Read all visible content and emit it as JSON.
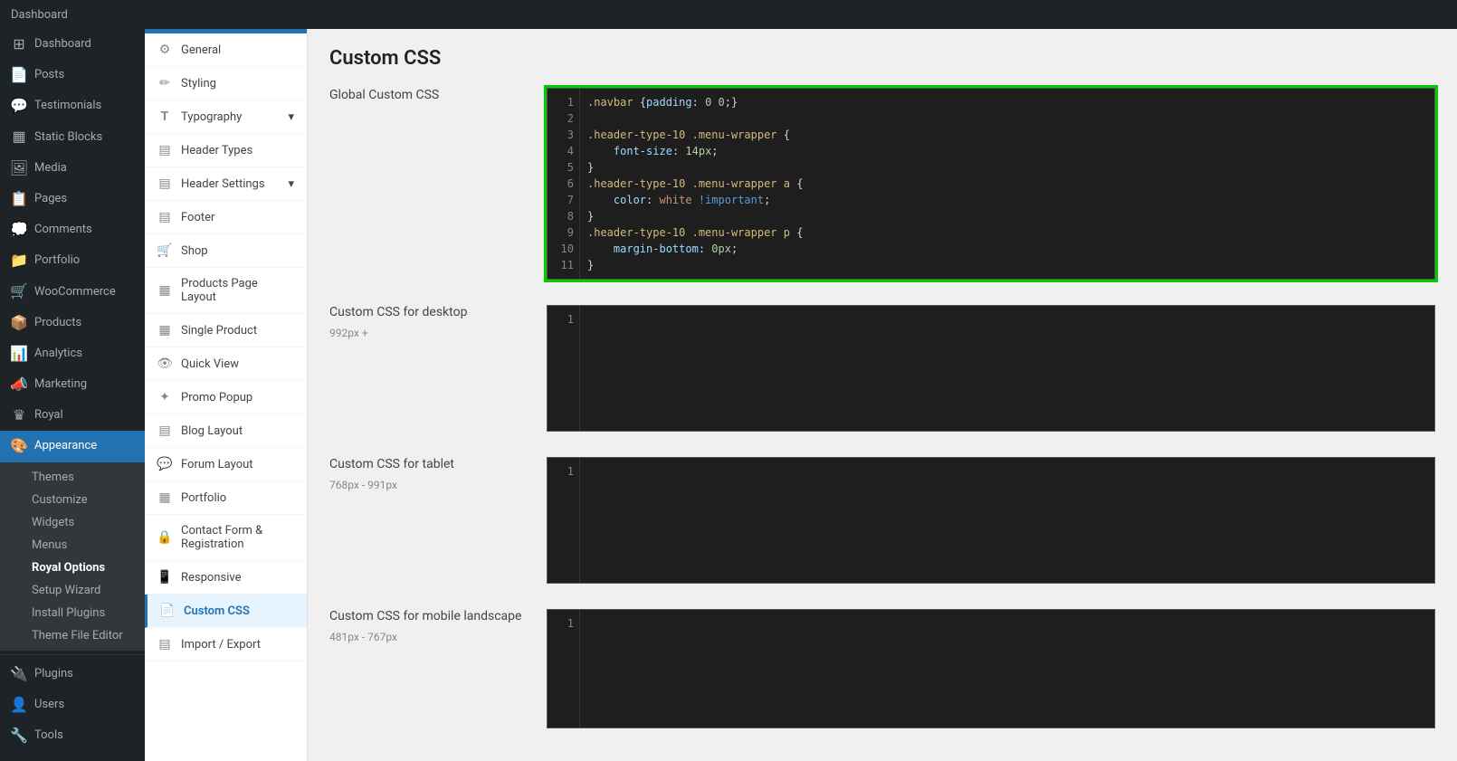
{
  "adminBar": {
    "dashboardLabel": "Dashboard"
  },
  "sidebar": {
    "items": [
      {
        "id": "dashboard",
        "label": "Dashboard",
        "icon": "⊞",
        "active": false
      },
      {
        "id": "posts",
        "label": "Posts",
        "icon": "📄",
        "active": false
      },
      {
        "id": "testimonials",
        "label": "Testimonials",
        "icon": "💬",
        "active": false
      },
      {
        "id": "static-blocks",
        "label": "Static Blocks",
        "icon": "▦",
        "active": false
      },
      {
        "id": "media",
        "label": "Media",
        "icon": "🖼",
        "active": false
      },
      {
        "id": "pages",
        "label": "Pages",
        "icon": "📋",
        "active": false
      },
      {
        "id": "comments",
        "label": "Comments",
        "icon": "💭",
        "active": false
      },
      {
        "id": "portfolio",
        "label": "Portfolio",
        "icon": "📁",
        "active": false
      },
      {
        "id": "woocommerce",
        "label": "WooCommerce",
        "icon": "🛒",
        "active": false
      },
      {
        "id": "products",
        "label": "Products",
        "icon": "📦",
        "active": false
      },
      {
        "id": "analytics",
        "label": "Analytics",
        "icon": "📊",
        "active": false
      },
      {
        "id": "marketing",
        "label": "Marketing",
        "icon": "📣",
        "active": false
      },
      {
        "id": "royal",
        "label": "Royal",
        "icon": "♛",
        "active": false
      },
      {
        "id": "appearance",
        "label": "Appearance",
        "icon": "🎨",
        "active": true
      }
    ],
    "appearanceSubItems": [
      {
        "id": "themes",
        "label": "Themes",
        "active": false
      },
      {
        "id": "customize",
        "label": "Customize",
        "active": false
      },
      {
        "id": "widgets",
        "label": "Widgets",
        "active": false
      },
      {
        "id": "menus",
        "label": "Menus",
        "active": false
      },
      {
        "id": "royal-options",
        "label": "Royal Options",
        "active": false,
        "bold": true
      },
      {
        "id": "setup-wizard",
        "label": "Setup Wizard",
        "active": false
      },
      {
        "id": "install-plugins",
        "label": "Install Plugins",
        "active": false
      },
      {
        "id": "theme-file-editor",
        "label": "Theme File Editor",
        "active": false
      }
    ],
    "bottomItems": [
      {
        "id": "plugins",
        "label": "Plugins",
        "icon": "🔌"
      },
      {
        "id": "users",
        "label": "Users",
        "icon": "👤"
      },
      {
        "id": "tools",
        "label": "Tools",
        "icon": "🔧"
      }
    ]
  },
  "secondaryNav": {
    "items": [
      {
        "id": "general",
        "label": "General",
        "icon": "⚙"
      },
      {
        "id": "styling",
        "label": "Styling",
        "icon": "✏"
      },
      {
        "id": "typography",
        "label": "Typography",
        "icon": "T",
        "hasArrow": true
      },
      {
        "id": "header-types",
        "label": "Header Types",
        "icon": "▤"
      },
      {
        "id": "header-settings",
        "label": "Header Settings",
        "icon": "▤",
        "hasArrow": true
      },
      {
        "id": "footer",
        "label": "Footer",
        "icon": "▤"
      },
      {
        "id": "shop",
        "label": "Shop",
        "icon": "🛒"
      },
      {
        "id": "products-page-layout",
        "label": "Products Page Layout",
        "icon": "▦"
      },
      {
        "id": "single-product",
        "label": "Single Product",
        "icon": "▦"
      },
      {
        "id": "quick-view",
        "label": "Quick View",
        "icon": "👁"
      },
      {
        "id": "promo-popup",
        "label": "Promo Popup",
        "icon": "✦"
      },
      {
        "id": "blog-layout",
        "label": "Blog Layout",
        "icon": "▤"
      },
      {
        "id": "forum-layout",
        "label": "Forum Layout",
        "icon": "💬"
      },
      {
        "id": "portfolio",
        "label": "Portfolio",
        "icon": "▦"
      },
      {
        "id": "contact-form-registration",
        "label": "Contact Form & Registration",
        "icon": "🔒"
      },
      {
        "id": "responsive",
        "label": "Responsive",
        "icon": "📱"
      },
      {
        "id": "custom-css",
        "label": "Custom CSS",
        "icon": "📄",
        "active": true
      },
      {
        "id": "import-export",
        "label": "Import / Export",
        "icon": "▤"
      }
    ]
  },
  "mainContent": {
    "pageTitle": "Custom CSS",
    "sections": [
      {
        "id": "global",
        "label": "Global Custom CSS",
        "sublabel": "",
        "codeLines": [
          {
            "num": "1",
            "content": ".navbar {padding: 0 0;}"
          },
          {
            "num": "2",
            "content": ""
          },
          {
            "num": "3",
            "content": ".header-type-10 .menu-wrapper {"
          },
          {
            "num": "4",
            "content": "    font-size: 14px;"
          },
          {
            "num": "5",
            "content": "}"
          },
          {
            "num": "6",
            "content": ".header-type-10 .menu-wrapper a {"
          },
          {
            "num": "7",
            "content": "    color: white !important;"
          },
          {
            "num": "8",
            "content": "}"
          },
          {
            "num": "9",
            "content": ".header-type-10 .menu-wrapper p {"
          },
          {
            "num": "10",
            "content": "    margin-bottom: 0px;"
          },
          {
            "num": "11",
            "content": "}"
          }
        ],
        "highlighted": true,
        "warningLine": "7"
      },
      {
        "id": "desktop",
        "label": "Custom CSS for desktop",
        "sublabel": "992px +",
        "codeLines": [
          {
            "num": "1",
            "content": ""
          }
        ],
        "highlighted": false
      },
      {
        "id": "tablet",
        "label": "Custom CSS for tablet",
        "sublabel": "768px - 991px",
        "codeLines": [
          {
            "num": "1",
            "content": ""
          }
        ],
        "highlighted": false
      },
      {
        "id": "mobile-landscape",
        "label": "Custom CSS for mobile landscape",
        "sublabel": "481px - 767px",
        "codeLines": [
          {
            "num": "1",
            "content": ""
          }
        ],
        "highlighted": false
      }
    ]
  }
}
